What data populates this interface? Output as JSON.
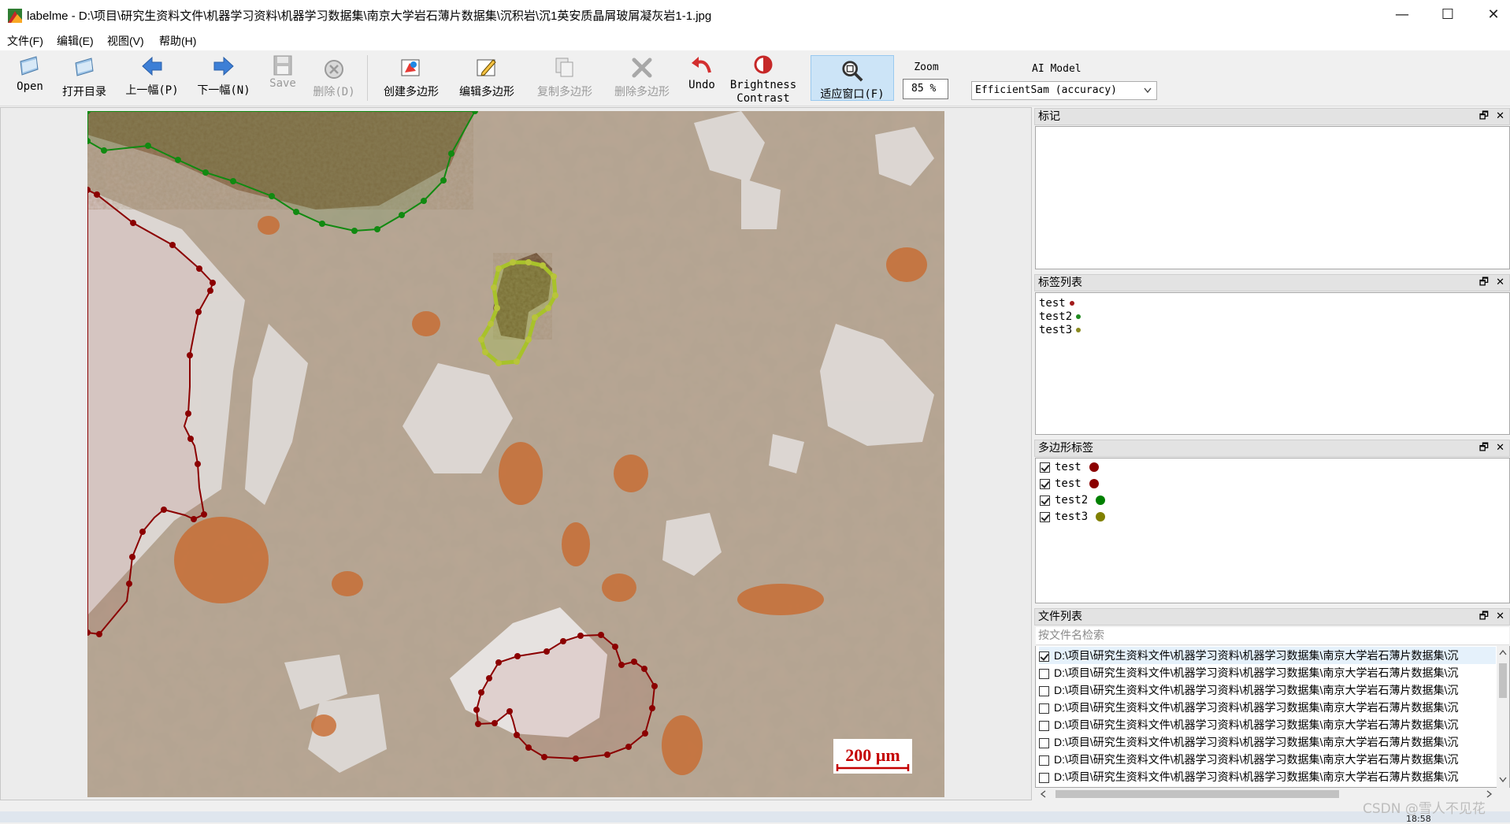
{
  "window": {
    "title": "labelme - D:\\项目\\研究生资料文件\\机器学习资料\\机器学习数据集\\南京大学岩石薄片数据集\\沉积岩\\沉1英安质晶屑玻屑凝灰岩1-1.jpg",
    "minimize": "—",
    "maximize": "☐",
    "close": "✕"
  },
  "menu": [
    "文件(F)",
    "编辑(E)",
    "视图(V)",
    "帮助(H)"
  ],
  "toolbar": {
    "open": "Open",
    "open_dir": "打开目录",
    "prev": "上一幅(P)",
    "next": "下一幅(N)",
    "save": "Save",
    "delete_file": "删除(D)",
    "create_polygon": "创建多边形",
    "edit_polygon": "编辑多边形",
    "copy_polygon": "复制多边形",
    "delete_polygon": "删除多边形",
    "undo": "Undo",
    "brightness_1": "Brightness",
    "brightness_2": "Contrast",
    "fit_window": "适应窗口(F)",
    "zoom_label": "Zoom",
    "zoom_value": "85 %",
    "ai_model_label": "AI Model",
    "ai_model_value": "EfficientSam (accuracy)"
  },
  "canvas": {
    "scale_bar_text": "200 µm"
  },
  "panels": {
    "flags": {
      "title": "标记"
    },
    "label_list": {
      "title": "标签列表",
      "items": [
        {
          "name": "test",
          "color": "#a11a1a"
        },
        {
          "name": "test2",
          "color": "#1f8a1f"
        },
        {
          "name": "test3",
          "color": "#8a8a1f"
        }
      ]
    },
    "polygon_labels": {
      "title": "多边形标签",
      "items": [
        {
          "name": "test",
          "color": "#8b0000",
          "checked": true
        },
        {
          "name": "test",
          "color": "#8b0000",
          "checked": true
        },
        {
          "name": "test2",
          "color": "#008000",
          "checked": true
        },
        {
          "name": "test3",
          "color": "#808000",
          "checked": true
        }
      ]
    },
    "file_list": {
      "title": "文件列表",
      "search_placeholder": "按文件名检索",
      "items": [
        "D:\\项目\\研究生资料文件\\机器学习资料\\机器学习数据集\\南京大学岩石薄片数据集\\沉",
        "D:\\项目\\研究生资料文件\\机器学习资料\\机器学习数据集\\南京大学岩石薄片数据集\\沉",
        "D:\\项目\\研究生资料文件\\机器学习资料\\机器学习数据集\\南京大学岩石薄片数据集\\沉",
        "D:\\项目\\研究生资料文件\\机器学习资料\\机器学习数据集\\南京大学岩石薄片数据集\\沉",
        "D:\\项目\\研究生资料文件\\机器学习资料\\机器学习数据集\\南京大学岩石薄片数据集\\沉",
        "D:\\项目\\研究生资料文件\\机器学习资料\\机器学习数据集\\南京大学岩石薄片数据集\\沉",
        "D:\\项目\\研究生资料文件\\机器学习资料\\机器学习数据集\\南京大学岩石薄片数据集\\沉",
        "D:\\项目\\研究生资料文件\\机器学习资料\\机器学习数据集\\南京大学岩石薄片数据集\\沉"
      ],
      "checked": [
        true,
        false,
        false,
        false,
        false,
        false,
        false,
        false
      ]
    },
    "float_icon": "🗗",
    "close_icon": "✕"
  },
  "watermark": "CSDN @雪人不见花",
  "clock": "18:58"
}
